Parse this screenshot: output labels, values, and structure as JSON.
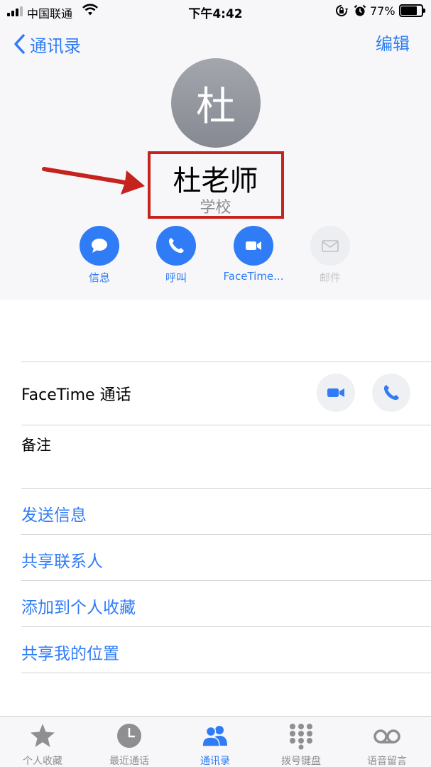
{
  "status_bar": {
    "carrier": "中国联通",
    "time": "下午4:42",
    "battery": "77%"
  },
  "nav": {
    "back_label": "通讯录",
    "edit_label": "编辑"
  },
  "contact": {
    "avatar_initial": "杜",
    "name": "杜老师",
    "organization": "学校"
  },
  "actions": [
    {
      "label": "信息",
      "icon": "message-icon",
      "enabled": true
    },
    {
      "label": "呼叫",
      "icon": "phone-icon",
      "enabled": true
    },
    {
      "label": "FaceTime...",
      "icon": "video-icon",
      "enabled": true
    },
    {
      "label": "邮件",
      "icon": "mail-icon",
      "enabled": false
    }
  ],
  "details": {
    "facetime_label": "FaceTime 通话",
    "notes_label": "备注"
  },
  "links": [
    "发送信息",
    "共享联系人",
    "添加到个人收藏",
    "共享我的位置"
  ],
  "tabs": [
    {
      "label": "个人收藏",
      "icon": "star-icon",
      "active": false
    },
    {
      "label": "最近通话",
      "icon": "clock-icon",
      "active": false
    },
    {
      "label": "通讯录",
      "icon": "contacts-icon",
      "active": true
    },
    {
      "label": "拨号键盘",
      "icon": "keypad-icon",
      "active": false
    },
    {
      "label": "语音留言",
      "icon": "voicemail-icon",
      "active": false
    }
  ],
  "colors": {
    "accent": "#2f7cf6",
    "highlight": "#c6221e",
    "annotation_arrow": "#c6221e"
  }
}
